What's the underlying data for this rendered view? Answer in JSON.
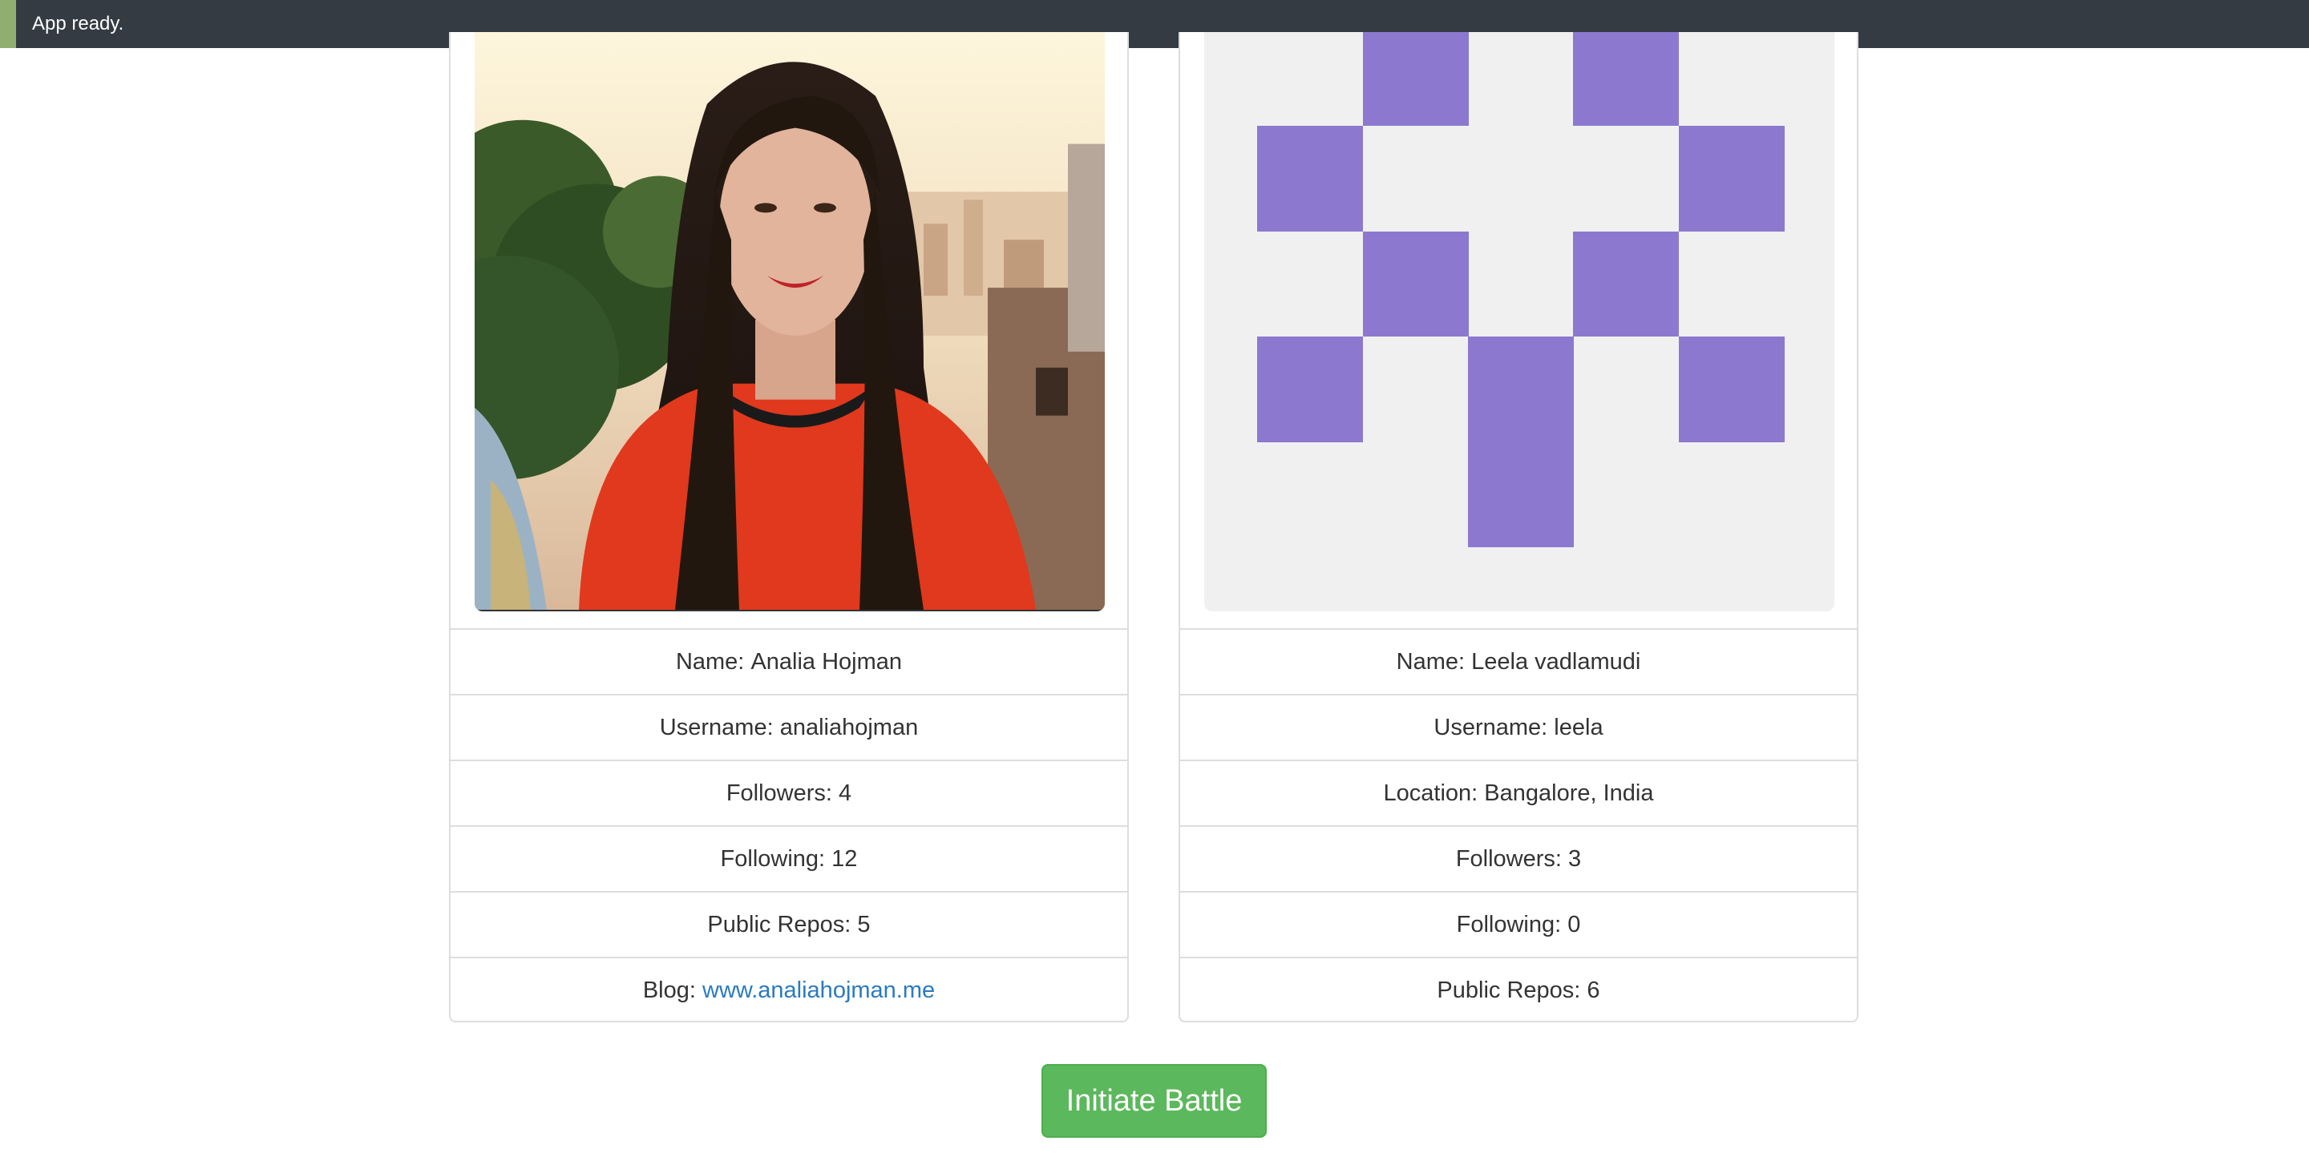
{
  "status_bar": {
    "text": "App ready.",
    "accent_color": "#8fae6f",
    "background_color": "#353b43"
  },
  "players": [
    {
      "avatar": "photo-avatar",
      "rows": [
        {
          "label": "Name: ",
          "value": "Analia Hojman"
        },
        {
          "label": "Username: ",
          "value": "analiahojman"
        },
        {
          "label": "Followers: ",
          "value": "4"
        },
        {
          "label": "Following: ",
          "value": "12"
        },
        {
          "label": "Public Repos: ",
          "value": "5"
        },
        {
          "label": "Blog: ",
          "value": "www.analiahojman.me",
          "link": true
        }
      ]
    },
    {
      "avatar": "identicon-avatar",
      "identicon_color": "#8c79cf",
      "rows": [
        {
          "label": "Name: ",
          "value": "Leela vadlamudi"
        },
        {
          "label": "Username: ",
          "value": "leela"
        },
        {
          "label": "Location: ",
          "value": "Bangalore, India"
        },
        {
          "label": "Followers: ",
          "value": "3"
        },
        {
          "label": "Following: ",
          "value": "0"
        },
        {
          "label": "Public Repos: ",
          "value": "6"
        }
      ]
    }
  ],
  "battle_button": {
    "label": "Initiate Battle",
    "color": "#5cb85c"
  }
}
